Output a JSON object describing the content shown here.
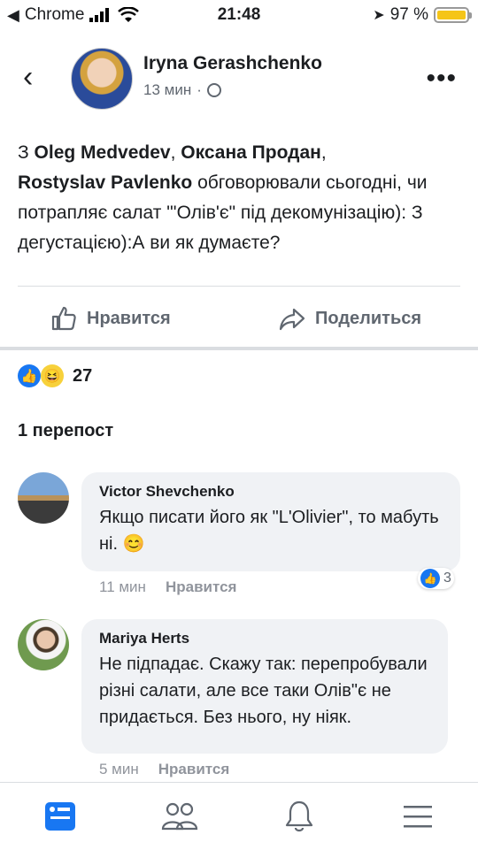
{
  "status_bar": {
    "carrier": "Chrome",
    "time": "21:48",
    "battery": "97 %"
  },
  "post": {
    "author": "Iryna Gerashchenko",
    "time": "13 мин",
    "separator": "·",
    "text_intro": "З ",
    "tag1": "Oleg Medvedev",
    "sep1": ", ",
    "tag2": "Оксана Продан",
    "sep2": ",",
    "tag3": "Rostyslav Pavlenko",
    "text_body": "  обговорювали сьогодні, чи потрапляє салат \"'Олів'є\" під декомунізацію): З дегустацією):А ви як думаєте?"
  },
  "actions": {
    "like": "Нравится",
    "share": "Поделиться"
  },
  "reactions": {
    "count": "27"
  },
  "shares": {
    "label": "1 перепост"
  },
  "comments": [
    {
      "name": "Victor Shevchenko",
      "text": "Якщо писати його як \"L'Olivier\", то мабуть ні. 😊",
      "time": "11 мин",
      "like_label": "Нравится",
      "reaction_count": "3"
    },
    {
      "name": "Mariya Herts",
      "text": "Не підпадає. Скажу так: перепробували різні салати, але все таки Олів\"є не придається. Без нього, ну ніяк.",
      "time": "5 мин",
      "like_label": "Нравится"
    }
  ],
  "colors": {
    "accent": "#1877f2",
    "bubble": "#f0f2f5"
  }
}
